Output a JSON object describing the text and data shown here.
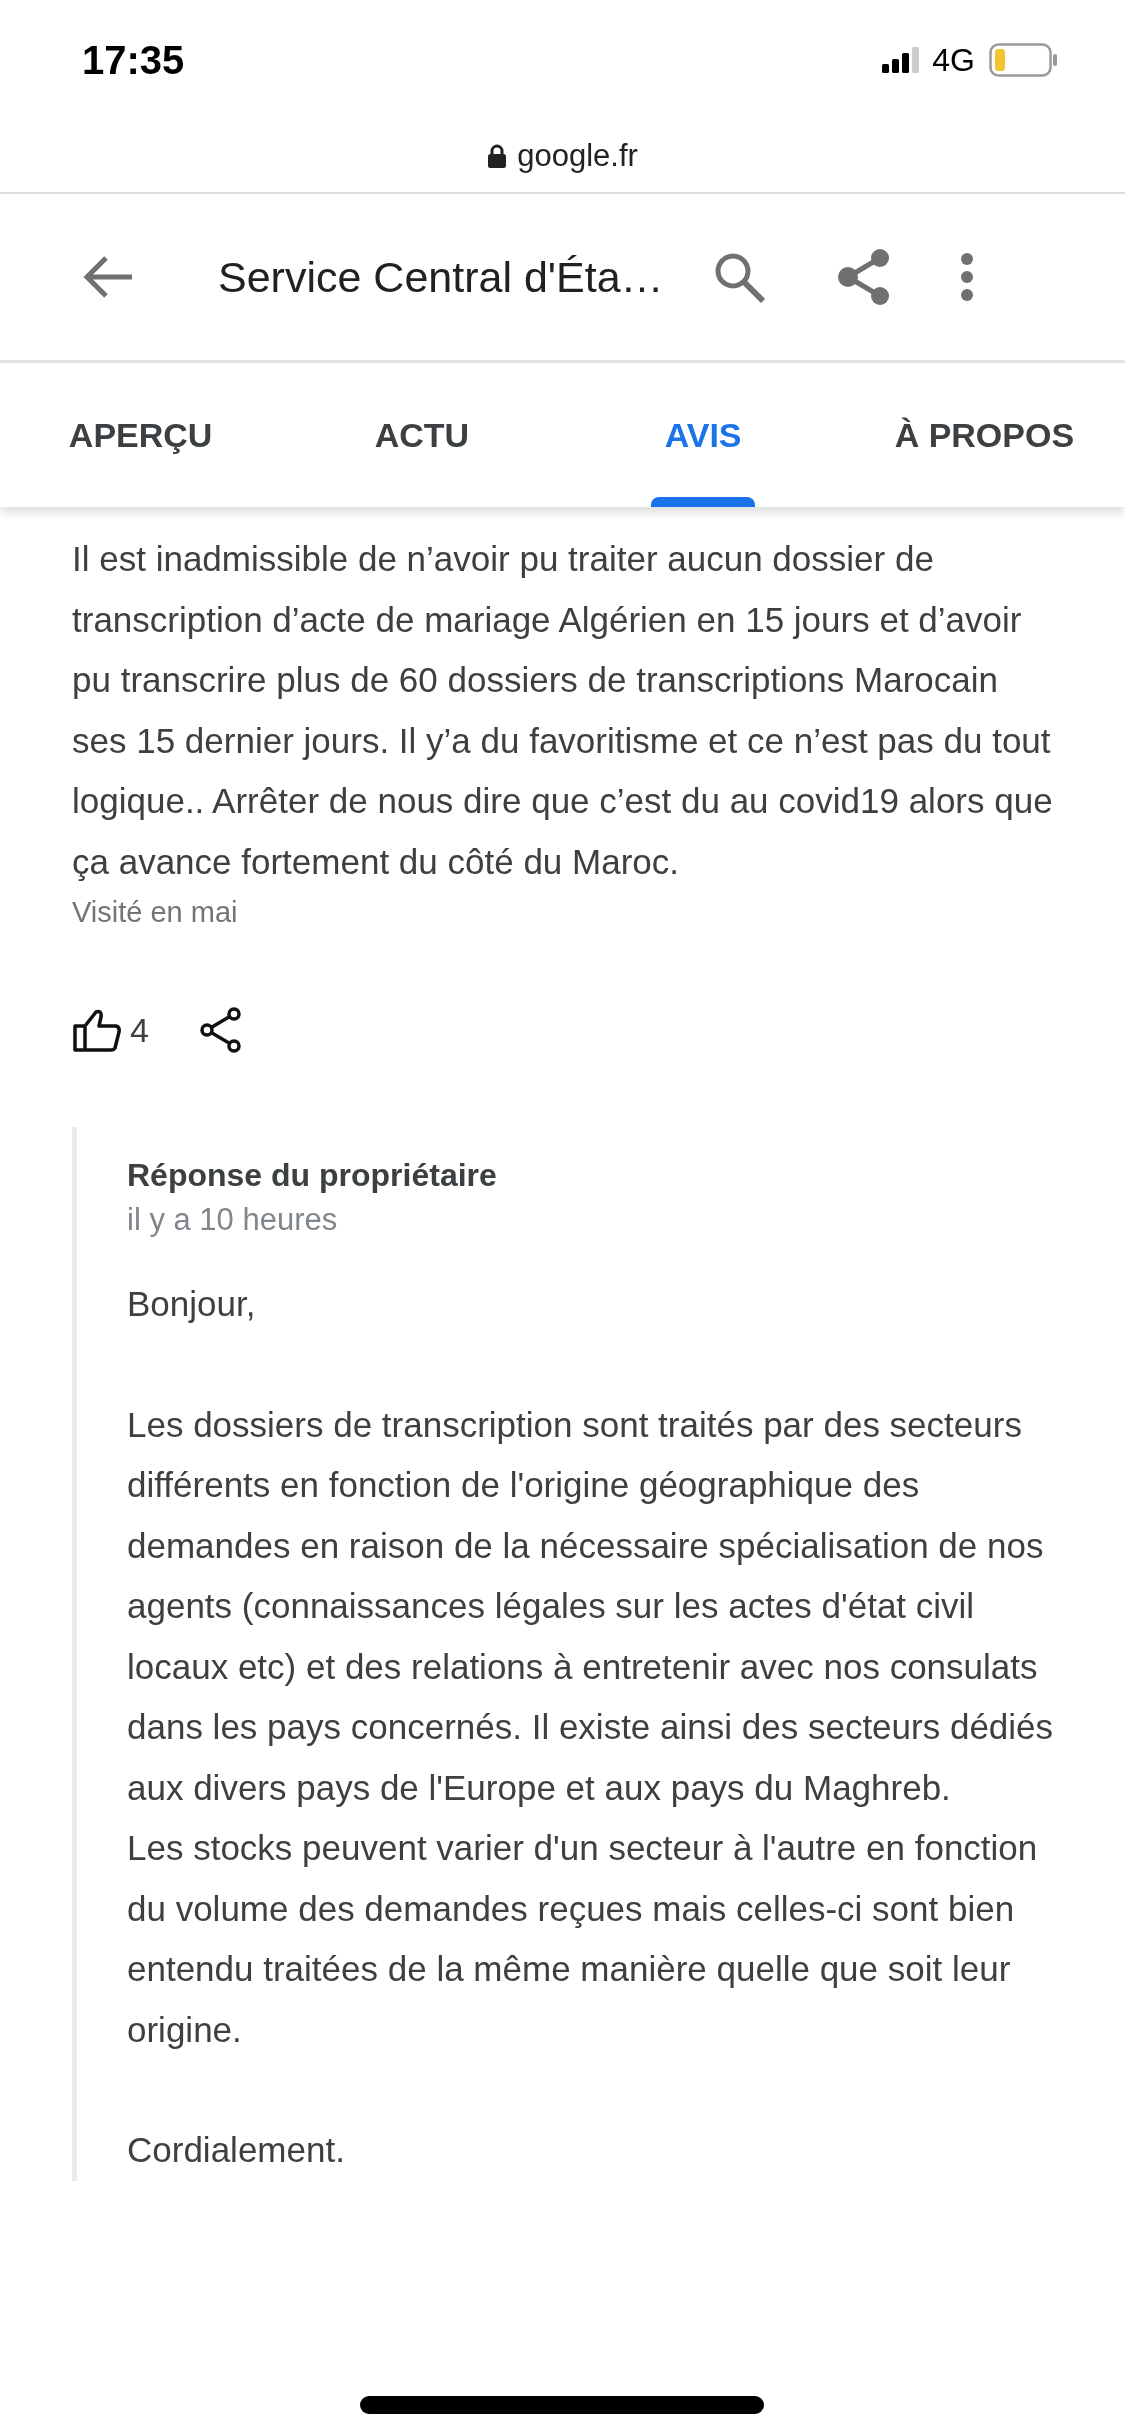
{
  "status_bar": {
    "time": "17:35",
    "network": "4G"
  },
  "address_bar": {
    "url": "google.fr"
  },
  "header": {
    "title": "Service Central d'Éta…"
  },
  "tabs": [
    {
      "label": "APERÇU",
      "selected": false
    },
    {
      "label": "ACTU",
      "selected": false
    },
    {
      "label": "AVIS",
      "selected": true
    },
    {
      "label": "À PROPOS",
      "selected": false
    }
  ],
  "review": {
    "text": "Il est inadmissible de n’avoir pu traiter aucun dossier de transcription d’acte de mariage Algérien en 15 jours et d’avoir pu transcrire plus de 60 dossiers de transcriptions Marocain ses 15 dernier jours. Il y’a du favoritisme et ce n’est pas du tout logique.. Arrêter de nous dire que c’est du au covid19 alors que ça avance fortement du côté du Maroc.",
    "visited": "Visité en mai",
    "likes": "4"
  },
  "owner_reply": {
    "title": "Réponse du propriétaire",
    "time": "il y a 10 heures",
    "paragraphs": [
      "Bonjour,",
      "Les dossiers de transcription sont traités par des secteurs différents en fonction de l'origine géographique des demandes en raison de la nécessaire spécialisation de nos agents (connaissances légales sur les actes d'état civil locaux etc) et des relations à entretenir avec nos consulats dans les pays concernés. Il existe ainsi des secteurs dédiés aux divers pays de l'Europe et aux pays du Maghreb.\nLes stocks peuvent varier d'un secteur à l'autre en fonction du volume des demandes reçues mais celles-ci sont bien entendu traitées de la même manière quelle que soit leur origine.",
      "Cordialement."
    ]
  }
}
